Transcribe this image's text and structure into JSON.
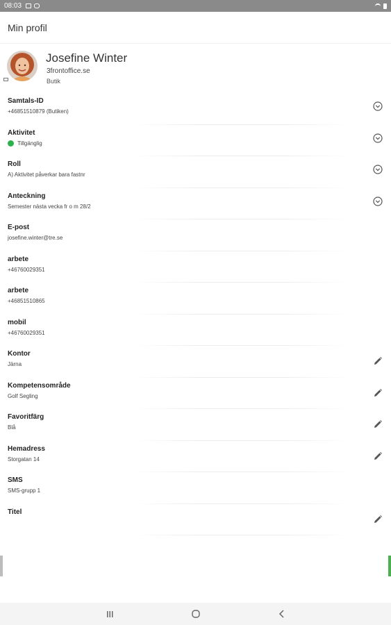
{
  "statusbar": {
    "time": "08:03"
  },
  "appbar": {
    "title": "Min profil"
  },
  "profile": {
    "name": "Josefine Winter",
    "domain": "3frontoffice.se",
    "role": "Butik"
  },
  "colors": {
    "available": "#2bb24c",
    "accent": "#4caf50"
  },
  "fields": [
    {
      "name": "samtals-id",
      "label": "Samtals-ID",
      "value": "+46851510879 (Butiken)",
      "action": "chevron-down-icon"
    },
    {
      "name": "aktivitet",
      "label": "Aktivitet",
      "value": "Tillgänglig",
      "action": "chevron-down-icon",
      "status": "available"
    },
    {
      "name": "roll",
      "label": "Roll",
      "value": "A) Aktivitet påverkar bara fastnr",
      "action": "chevron-down-icon"
    },
    {
      "name": "anteckning",
      "label": "Anteckning",
      "value": "Semester nästa vecka fr o m 28/2",
      "action": "chevron-down-icon"
    },
    {
      "name": "e-post",
      "label": "E-post",
      "value": "josefine.winter@tre.se",
      "action": ""
    },
    {
      "name": "arbete-1",
      "label": "arbete",
      "value": "+46760029351",
      "action": ""
    },
    {
      "name": "arbete-2",
      "label": "arbete",
      "value": "+46851510865",
      "action": ""
    },
    {
      "name": "mobil",
      "label": "mobil",
      "value": "+46760029351",
      "action": ""
    },
    {
      "name": "kontor",
      "label": "Kontor",
      "value": "Järna",
      "action": "pencil-icon"
    },
    {
      "name": "kompetensomrade",
      "label": "Kompetensområde",
      "value": "Golf Segling",
      "action": "pencil-icon"
    },
    {
      "name": "favoritfarg",
      "label": "Favoritfärg",
      "value": "Blå",
      "action": "pencil-icon"
    },
    {
      "name": "hemadress",
      "label": "Hemadress",
      "value": "Storgatan 14",
      "action": "pencil-icon"
    },
    {
      "name": "sms",
      "label": "SMS",
      "value": "SMS-grupp 1",
      "action": ""
    },
    {
      "name": "titel",
      "label": "Titel",
      "value": "",
      "action": "pencil-icon"
    }
  ],
  "navbar": {
    "items": [
      "recent-apps-icon",
      "home-icon",
      "back-icon"
    ]
  }
}
